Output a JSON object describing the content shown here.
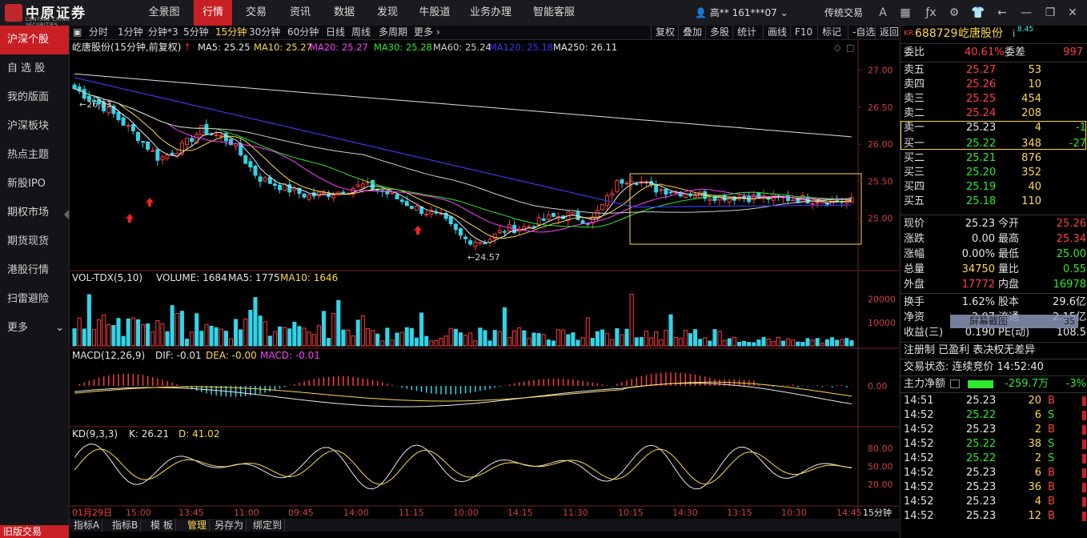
{
  "app": {
    "logo_text": "中原证券",
    "logo_sub": "CENTRAL CHINA SECURITIES"
  },
  "nav": [
    "全景图",
    "行情",
    "交易",
    "资讯",
    "数据",
    "发现",
    "牛股道",
    "业务办理",
    "智能客服"
  ],
  "nav_active": 1,
  "user": {
    "label": "高** 161***07 ",
    "mode": "传统交易"
  },
  "top_icons": [
    "font-size-icon",
    "grid-icon",
    "formula-icon",
    "gear-icon",
    "shirt-icon",
    "back-icon",
    "minimize-icon",
    "restore-icon",
    "close-icon"
  ],
  "sidebar": [
    "沪深个股",
    "自 选 股",
    "我的版面",
    "沪深板块",
    "热点主题",
    "新股IPO",
    "期权市场",
    "期货现货",
    "港股行情",
    "扫雷避险",
    "更多"
  ],
  "sidebar_active": 0,
  "old_version": "旧版交易",
  "toolbar": {
    "periods": [
      "分时",
      "1分钟",
      "分钟*3",
      "5分钟",
      "15分钟",
      "30分钟",
      "60分钟",
      "日线",
      "周线",
      "多周期",
      "更多"
    ],
    "period_active": 4,
    "tools": [
      "复权",
      "叠加",
      "多股",
      "统计",
      "画线",
      "F10",
      "标记",
      "-自选",
      "返回"
    ]
  },
  "chart_header": {
    "name": "屹唐股份(15分钟,前复权)",
    "ma": [
      {
        "label": "MA5: 25.25",
        "color": "#e8e8e8"
      },
      {
        "label": "MA10: 25.27",
        "color": "#ffd84d"
      },
      {
        "label": "MA20: 25.27",
        "color": "#ff40ff"
      },
      {
        "label": "MA30: 25.28",
        "color": "#2ee82e"
      },
      {
        "label": "MA60: 25.24",
        "color": "#d0d0d0"
      },
      {
        "label": "MA120: 25.18",
        "color": "#3a3af0"
      },
      {
        "label": "MA250: 26.11",
        "color": "#e8e8e8"
      }
    ]
  },
  "price_axis": [
    "27.00",
    "26.50",
    "26.00",
    "25.50",
    "25.00"
  ],
  "annotations": {
    "high": "26.83",
    "low": "24.57"
  },
  "volume": {
    "header": "VOL-TDX(5,10)",
    "volume": "VOLUME: 1684",
    "ma5": "MA5: 1775",
    "ma10": "MA10: 1646",
    "axis": [
      "20000",
      "10000"
    ]
  },
  "macd": {
    "header": "MACD(12,26,9)",
    "dif": "DIF: -0.01",
    "dea": "DEA: -0.00",
    "macd": "MACD: -0.01",
    "axis": [
      "0.00"
    ]
  },
  "kd": {
    "header": "KD(9,3,3)",
    "k": "K: 26.21",
    "d": "D: 41.02",
    "axis": [
      "80.00",
      "50.00",
      "20.00"
    ]
  },
  "time_axis": [
    "01月29日",
    "15:00",
    "13:45",
    "11:00",
    "09:45",
    "14:00",
    "11:15",
    "10:00",
    "14:15",
    "11:30",
    "10:15",
    "14:30",
    "13:15",
    "10:30",
    "14:45"
  ],
  "period_label": "15分钟",
  "bottom_tabs": [
    "指标A",
    "指标B",
    "模 板",
    "管理",
    "另存为",
    "绑定到"
  ],
  "bottom_active": 3,
  "quote": {
    "code": "688729",
    "name": "屹唐股份",
    "tag": "KR",
    "change_small": "8.45",
    "weibi_label": "委比",
    "weibi": "40.61%",
    "weicha_label": "委差",
    "weicha": "997",
    "asks": [
      {
        "label": "卖五",
        "price": "25.27",
        "vol": "53"
      },
      {
        "label": "卖四",
        "price": "25.26",
        "vol": "10"
      },
      {
        "label": "卖三",
        "price": "25.25",
        "vol": "454"
      },
      {
        "label": "卖二",
        "price": "25.24",
        "vol": "208"
      },
      {
        "label": "卖一",
        "price": "25.23",
        "vol": "4",
        "chg": "-1"
      }
    ],
    "bids": [
      {
        "label": "买一",
        "price": "25.22",
        "vol": "348",
        "chg": "-27"
      },
      {
        "label": "买二",
        "price": "25.21",
        "vol": "876"
      },
      {
        "label": "买三",
        "price": "25.20",
        "vol": "352"
      },
      {
        "label": "买四",
        "price": "25.19",
        "vol": "40"
      },
      {
        "label": "买五",
        "price": "25.18",
        "vol": "110"
      }
    ],
    "stats": [
      {
        "l1": "现价",
        "v1": "25.23",
        "c1": "white",
        "l2": "今开",
        "v2": "25.26",
        "c2": "red"
      },
      {
        "l1": "涨跌",
        "v1": "0.00",
        "c1": "white",
        "l2": "最高",
        "v2": "25.34",
        "c2": "red"
      },
      {
        "l1": "涨幅",
        "v1": "0.00%",
        "c1": "white",
        "l2": "最低",
        "v2": "25.00",
        "c2": "green"
      },
      {
        "l1": "总量",
        "v1": "34750",
        "c1": "yellow",
        "l2": "量比",
        "v2": "0.55",
        "c2": "green"
      },
      {
        "l1": "外盘",
        "v1": "17772",
        "c1": "red",
        "l2": "内盘",
        "v2": "16978",
        "c2": "green"
      }
    ],
    "stats2": [
      {
        "l1": "换手",
        "v1": "1.62%",
        "l2": "股本",
        "v2": "29.6亿"
      },
      {
        "l1": "净资",
        "v1": "2.07",
        "l2": "流通",
        "v2": "2.15亿"
      },
      {
        "l1": "收益(三)",
        "v1": "0.190",
        "l2": "PE(动)",
        "v2": "108.5"
      }
    ],
    "popup": "屏幕截图",
    "popup_val": "35",
    "flags": "注册制 已盈利 表决权无差异",
    "status_label": "交易状态:",
    "status": "连续竞价 14:52:40",
    "main_flow_label": "主力净额",
    "main_flow": "-259.7万",
    "main_flow_pct": "-3%",
    "ticks": [
      {
        "t": "14:51",
        "p": "25.23",
        "pc": "white",
        "v": "20",
        "d": "B"
      },
      {
        "t": "14:52",
        "p": "25.22",
        "pc": "green",
        "v": "6",
        "d": "S"
      },
      {
        "t": "14:52",
        "p": "25.23",
        "pc": "white",
        "v": "2",
        "d": "B"
      },
      {
        "t": "14:52",
        "p": "25.22",
        "pc": "green",
        "v": "38",
        "d": "S"
      },
      {
        "t": "14:52",
        "p": "25.22",
        "pc": "green",
        "v": "2",
        "d": "S"
      },
      {
        "t": "14:52",
        "p": "25.23",
        "pc": "white",
        "v": "6",
        "d": "B"
      },
      {
        "t": "14:52",
        "p": "25.23",
        "pc": "white",
        "v": "36",
        "d": "B"
      },
      {
        "t": "14:52",
        "p": "25.23",
        "pc": "white",
        "v": "4",
        "d": "B"
      },
      {
        "t": "14:52",
        "p": "25.23",
        "pc": "white",
        "v": "12",
        "d": "B"
      }
    ]
  },
  "colors": {
    "up": "#ff3b3b",
    "down": "#32d4e8",
    "accent": "#c81f25",
    "highlight": "#ffd84d"
  }
}
